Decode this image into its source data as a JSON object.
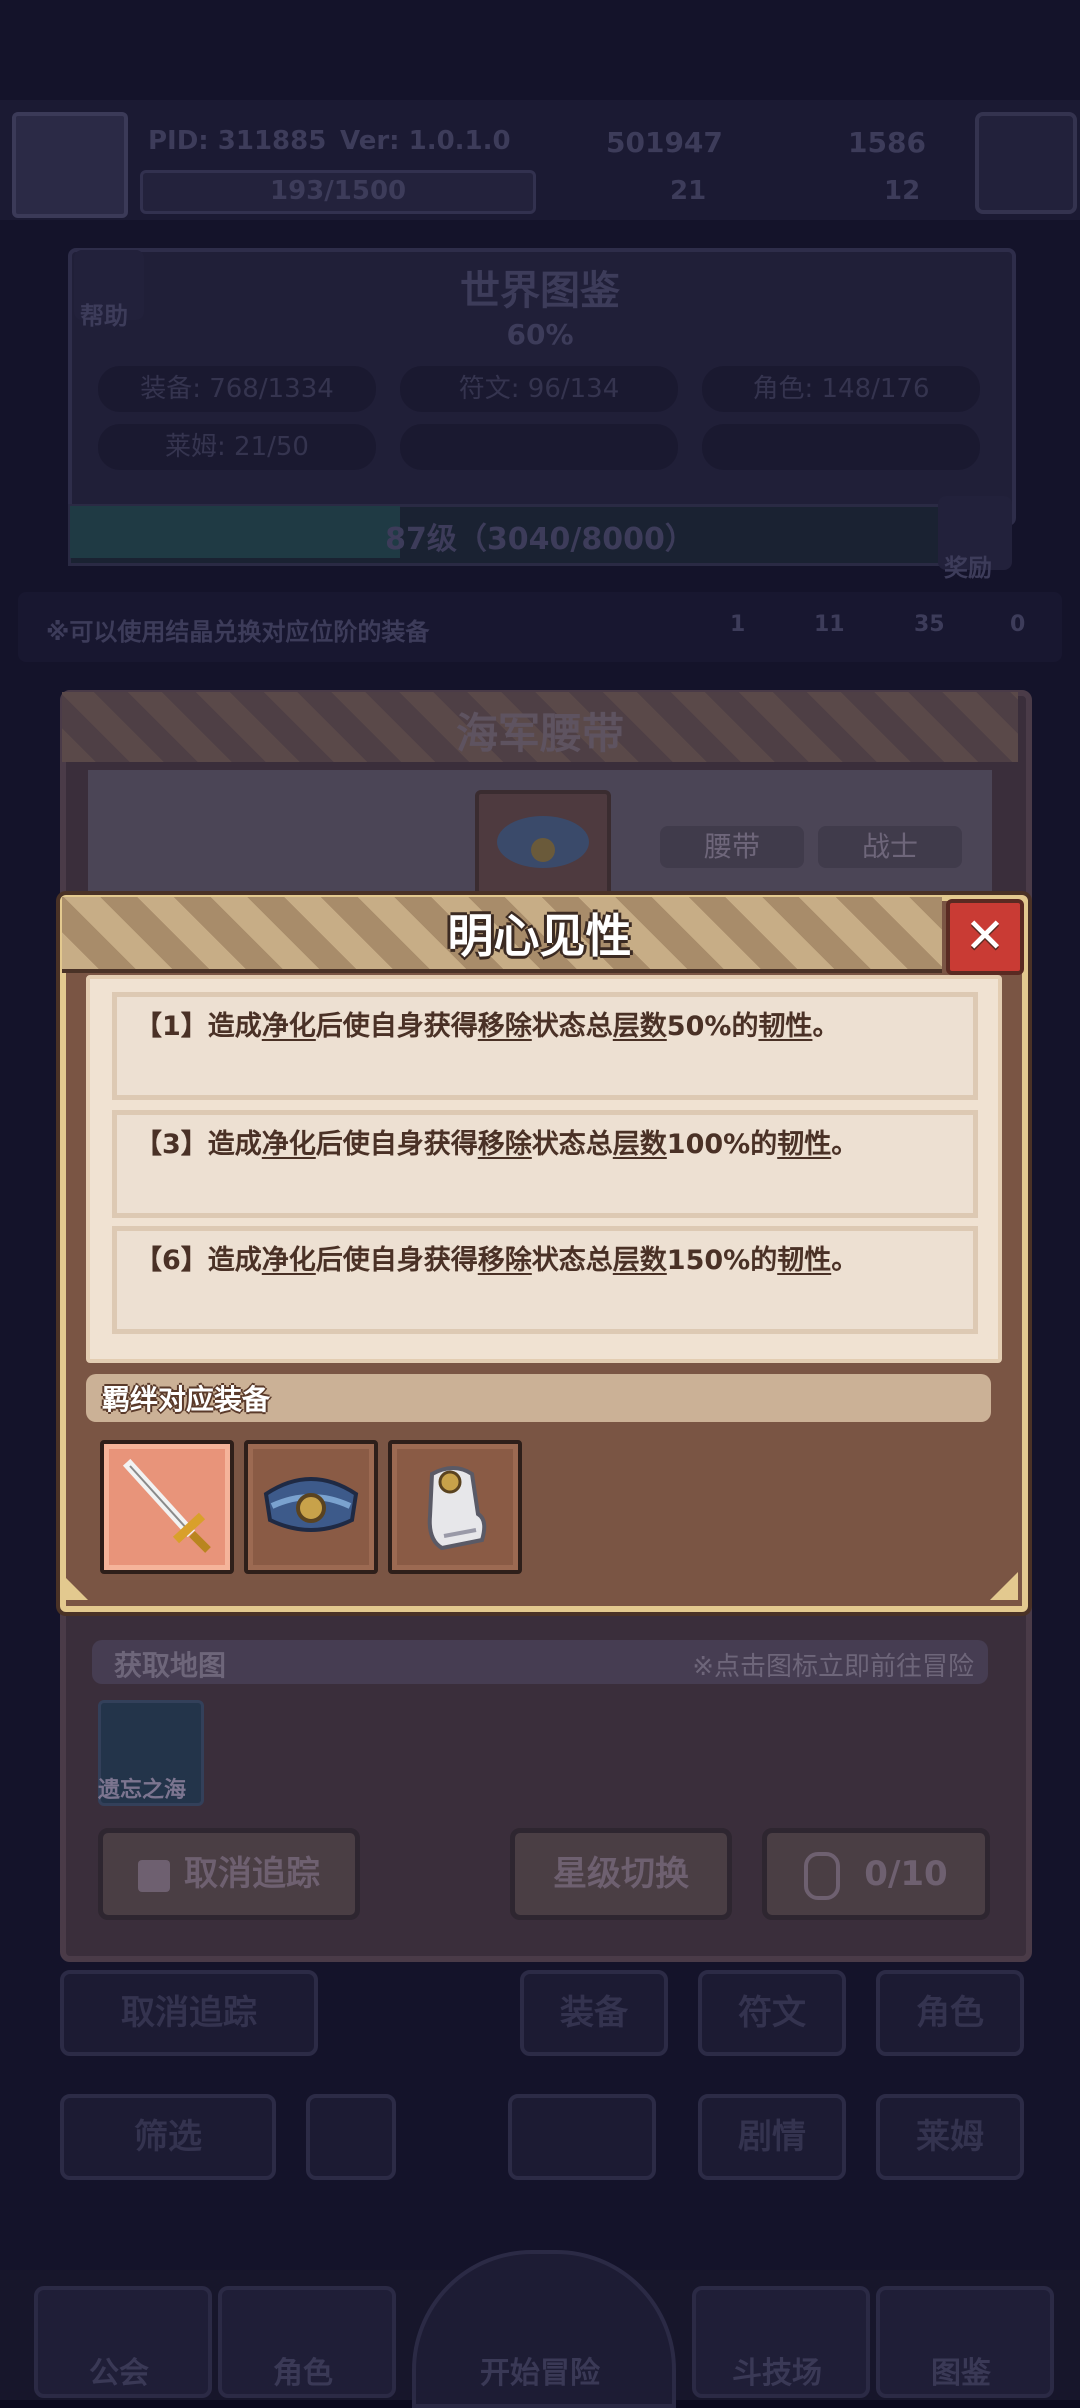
{
  "top_bar": {
    "pid": "PID: 311885",
    "version": "Ver: 1.0.1.0",
    "stamina": "193/1500",
    "gold": "501947",
    "gems": "1586",
    "stat_a": "21",
    "stat_b": "12"
  },
  "world_codex": {
    "help_label": "帮助",
    "title": "世界图鉴",
    "progress": "60%",
    "stats": [
      "装备: 768/1334",
      "符文: 96/134",
      "角色: 148/176",
      "莱姆: 21/50"
    ],
    "level": "87级（3040/8000）",
    "reward_label": "奖励",
    "hint": "※可以使用结晶兑换对应位阶的装备",
    "crystals": [
      "1",
      "11",
      "35",
      "0"
    ]
  },
  "item_panel": {
    "title": "海军腰带",
    "tags": [
      "腰带",
      "战士"
    ]
  },
  "modal": {
    "title": "明心见性",
    "close_icon": "close-icon",
    "effects": [
      {
        "tier": "【1】",
        "pre": "造成",
        "k1": "净化",
        "mid1": "后使自身获得",
        "k2": "移除",
        "mid2": "状态总",
        "k3": "层数",
        "pct": "50%",
        "mid3": "的",
        "k4": "韧性",
        "end": "。"
      },
      {
        "tier": "【3】",
        "pre": "造成",
        "k1": "净化",
        "mid1": "后使自身获得",
        "k2": "移除",
        "mid2": "状态总",
        "k3": "层数",
        "pct": "100%",
        "mid3": "的",
        "k4": "韧性",
        "end": "。"
      },
      {
        "tier": "【6】",
        "pre": "造成",
        "k1": "净化",
        "mid1": "后使自身获得",
        "k2": "移除",
        "mid2": "状态总",
        "k3": "层数",
        "pct": "150%",
        "mid3": "的",
        "k4": "韧性",
        "end": "。"
      }
    ],
    "bond_label": "羁绊对应装备",
    "equipment": [
      "sword-icon",
      "belt-icon",
      "glove-icon"
    ]
  },
  "map_section": {
    "title": "获取地图",
    "hint": "※点击图标立即前往冒险",
    "map_name": "遗忘之海"
  },
  "actions": {
    "untrack": "取消追踪",
    "star_switch": "星级切换",
    "crystal_count": "0/10"
  },
  "background_tabs": {
    "untrack": "取消追踪",
    "equip": "装备",
    "rune": "符文",
    "role": "角色",
    "filter": "筛选",
    "story": "剧情",
    "slime": "莱姆"
  },
  "bottom_nav": [
    "公会",
    "角色",
    "开始冒险",
    "斗技场",
    "图鉴"
  ]
}
